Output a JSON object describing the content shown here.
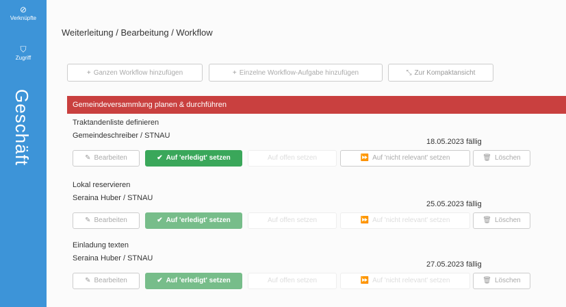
{
  "sidebar": {
    "items": [
      {
        "icon": "link-icon",
        "glyph": "⊘",
        "label": "Verknüpfte"
      },
      {
        "icon": "shield-icon",
        "glyph": "⛉",
        "label": "Zugriff"
      }
    ],
    "section_label": "Geschäft",
    "color": "#3d94d8"
  },
  "breadcrumb": "Weiterleitung / Bearbeitung / Workflow",
  "toolbar": {
    "add_workflow": "Ganzen Workflow hinzufügen",
    "add_task": "Einzelne Workflow-Aufgabe hinzufügen",
    "compact_view": "Zur Kompaktansicht"
  },
  "group": {
    "title": "Gemeindeversammlung planen & durchführen",
    "color": "#c9403f"
  },
  "labels": {
    "edit": "Bearbeiten",
    "set_done": "Auf 'erledigt' setzen",
    "set_open": "Auf offen setzen",
    "set_not_relevant": "Auf 'nicht relevant' setzen",
    "delete": "Löschen"
  },
  "tasks": [
    {
      "title": "Traktandenliste definieren",
      "assignee": "Gemeindeschreiber / STNAU",
      "due": "18.05.2023 fällig"
    },
    {
      "title": "Lokal reservieren",
      "assignee": "Seraina Huber / STNAU",
      "due": "25.05.2023 fällig"
    },
    {
      "title": "Einladung texten",
      "assignee": "Seraina Huber / STNAU",
      "due": "27.05.2023 fällig"
    }
  ],
  "colors": {
    "done_green": "#3aa75a",
    "done_green_light": "#77bd8a"
  }
}
